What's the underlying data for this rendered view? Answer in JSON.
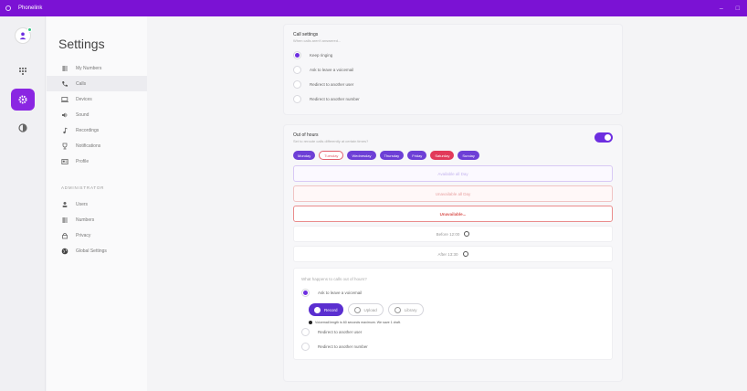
{
  "window": {
    "title": "Phonelink",
    "controls": [
      "–",
      "□"
    ]
  },
  "rail": {
    "items": [
      "profile",
      "dialpad",
      "settings",
      "theme"
    ]
  },
  "sidebar": {
    "title": "Settings",
    "items": [
      {
        "label": "My Numbers",
        "icon": "numbers-icon"
      },
      {
        "label": "Calls",
        "icon": "phone-icon"
      },
      {
        "label": "Devices",
        "icon": "devices-icon"
      },
      {
        "label": "Sound",
        "icon": "speaker-icon"
      },
      {
        "label": "Recordings",
        "icon": "music-note-icon"
      },
      {
        "label": "Notifications",
        "icon": "trophy-icon"
      },
      {
        "label": "Profile",
        "icon": "id-card-icon"
      }
    ],
    "admin_label": "ADMINISTRATOR",
    "admin_items": [
      {
        "label": "Users",
        "icon": "user-icon"
      },
      {
        "label": "Numbers",
        "icon": "numbers-icon"
      },
      {
        "label": "Privacy",
        "icon": "lock-icon"
      },
      {
        "label": "Global Settings",
        "icon": "globe-icon"
      }
    ]
  },
  "call_settings": {
    "title": "Call settings",
    "subtitle": "When calls aren't answered...",
    "options": [
      "Keep ringing",
      "Ask to leave a voicemail",
      "Redirect to another user",
      "Redirect to another number"
    ],
    "selected": 0
  },
  "out_of_hours": {
    "title": "Out of hours",
    "subtitle": "Set to reroute calls differently at certain times?",
    "enabled": true,
    "days": [
      "Monday",
      "Tuesday",
      "Wednesday",
      "Thursday",
      "Friday",
      "Saturday",
      "Sunday"
    ],
    "rows": [
      "Available all Day",
      "Unavailable all Day",
      "Unavailable...",
      "Before 12:00",
      "After 13:30"
    ],
    "question": "What happens to calls out of hours?",
    "options": [
      "Ask to leave a voicemail",
      "Redirect to another user",
      "Redirect to another number"
    ],
    "selected": 0,
    "buttons": [
      "Record",
      "Upload",
      "Library"
    ],
    "note": "Voicemail length is 60 seconds maximum. We save 1 draft."
  }
}
